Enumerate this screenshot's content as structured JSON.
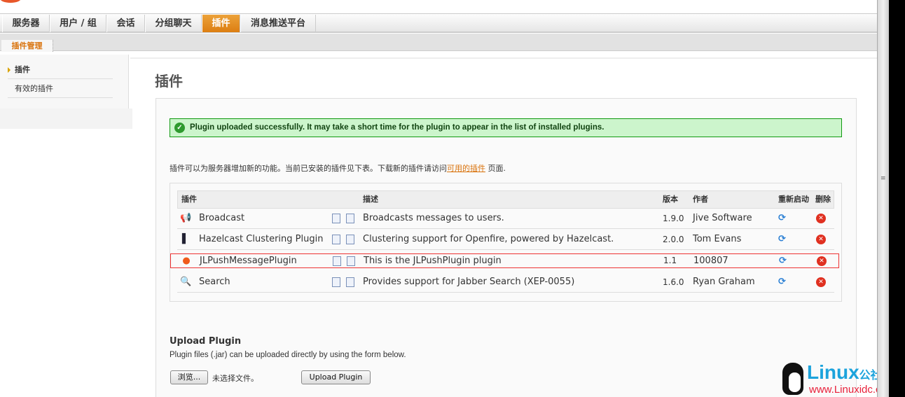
{
  "nav": {
    "tabs": [
      "服务器",
      "用户 / 组",
      "会话",
      "分组聊天",
      "插件",
      "消息推送平台"
    ],
    "active": 4
  },
  "subnav": {
    "tab": "插件管理"
  },
  "sidebar": {
    "items": [
      "插件",
      "有效的插件"
    ]
  },
  "main": {
    "title": "插件",
    "success": "Plugin uploaded successfully. It may take a short time for the plugin to appear in the list of installed plugins.",
    "intro_before": "插件可以为服务器增加新的功能。当前已安装的插件见下表。下载新的插件请访问",
    "intro_link": "可用的插件",
    "intro_after": " 页面.",
    "table": {
      "headers": [
        "插件",
        "描述",
        "版本",
        "作者",
        "重新启动",
        "删除"
      ],
      "rows": [
        {
          "name": "Broadcast",
          "desc": "Broadcasts messages to users.",
          "version": "1.9.0",
          "author": "Jive Software",
          "icon": "megaphone-icon"
        },
        {
          "name": "Hazelcast Clustering Plugin",
          "desc": "Clustering support for Openfire, powered by Hazelcast.",
          "version": "2.0.0",
          "author": "Tom Evans",
          "icon": "hazelcast-icon"
        },
        {
          "name": "JLPushMessagePlugin",
          "desc": "This is the JLPushPlugin plugin",
          "version": "1.1",
          "author": "100807",
          "icon": "openfire-icon"
        },
        {
          "name": "Search",
          "desc": "Provides support for Jabber Search (XEP-0055)",
          "version": "1.6.0",
          "author": "Ryan Graham",
          "icon": "magnifier-icon"
        }
      ]
    },
    "upload": {
      "title": "Upload Plugin",
      "text": "Plugin files (.jar) can be uploaded directly by using the form below.",
      "browse": "浏览...",
      "nofile": "未选择文件。",
      "button": "Upload Plugin"
    }
  },
  "watermark": {
    "line1": "Linux",
    "line1b": "公社",
    "line2": "www.Linuxidc.com"
  }
}
